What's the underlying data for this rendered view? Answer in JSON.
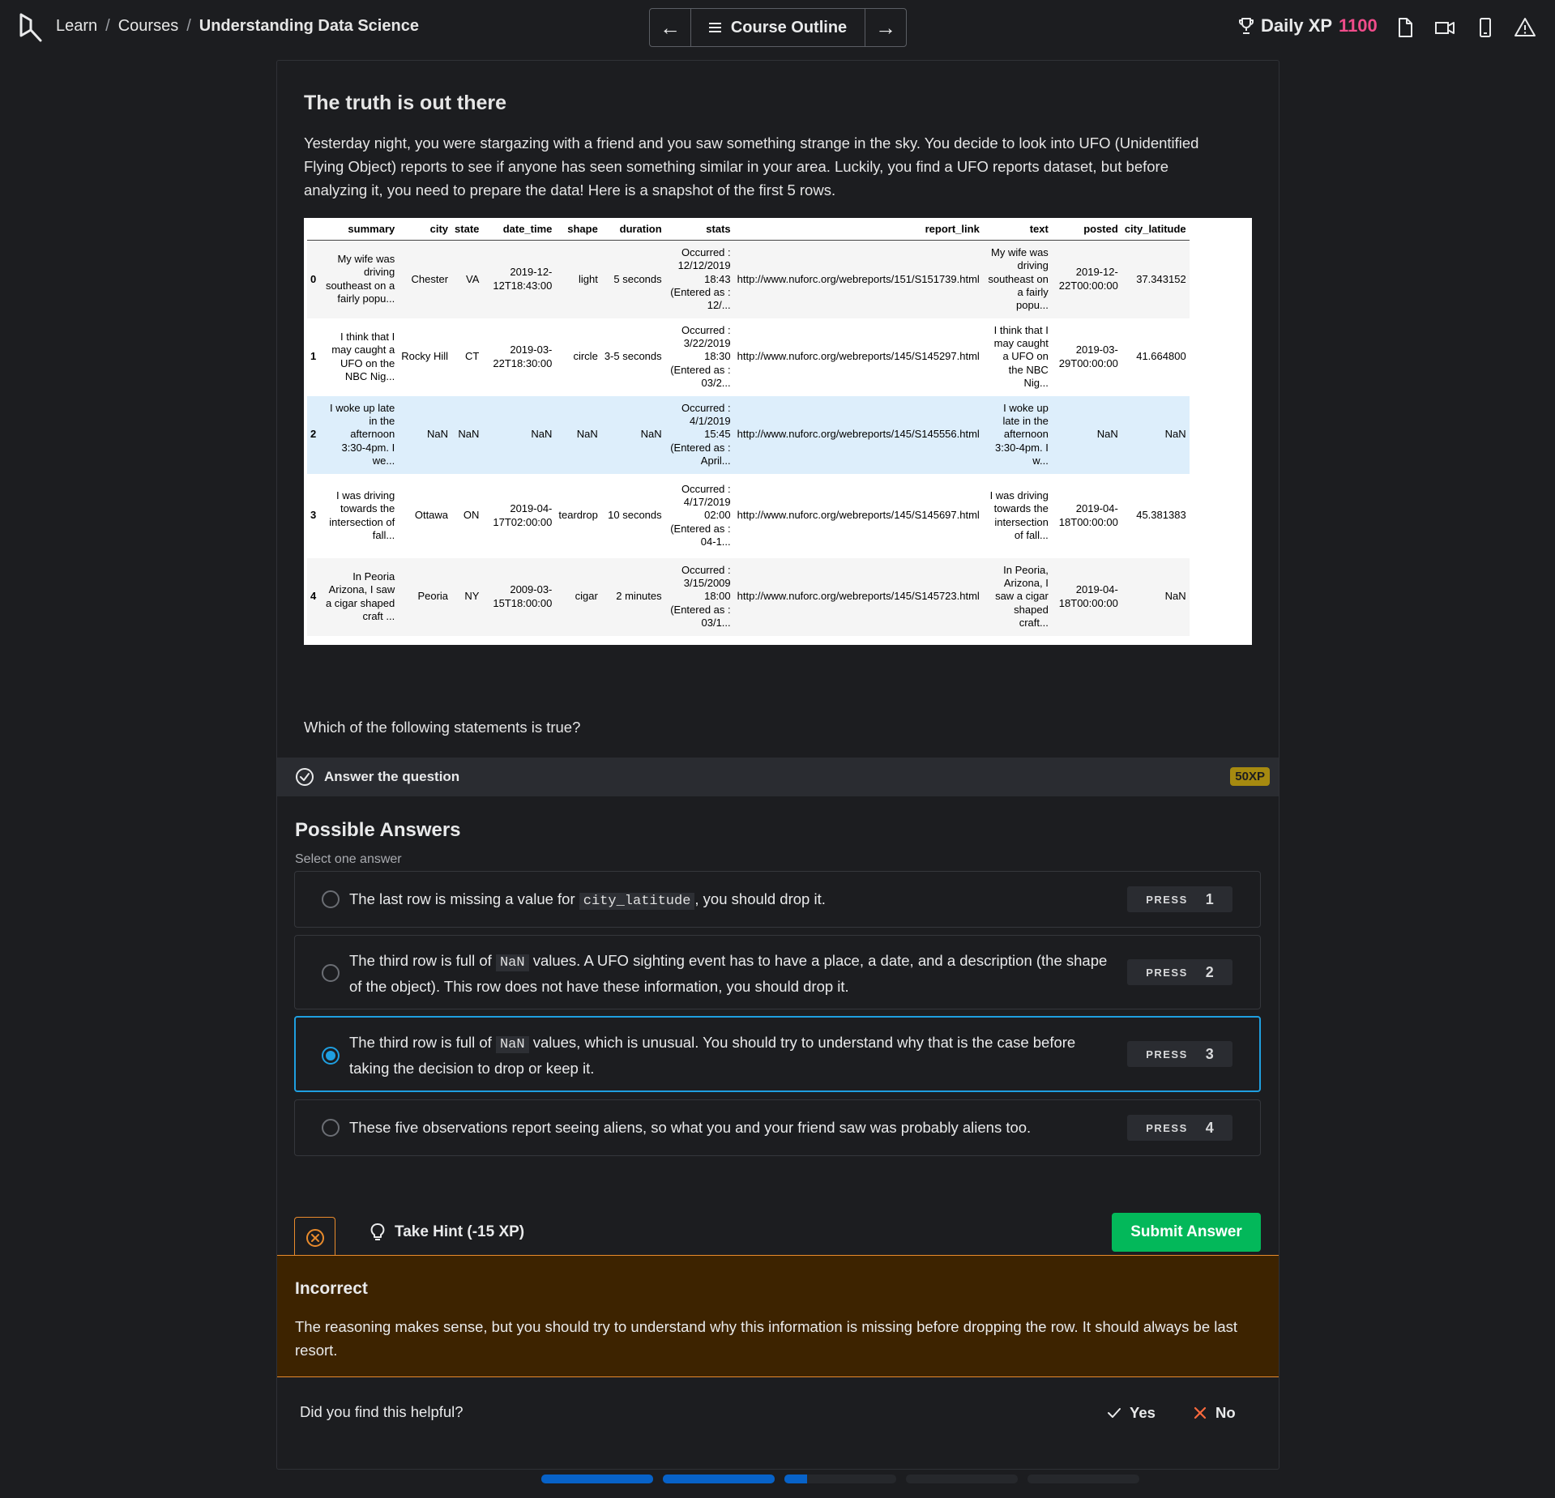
{
  "breadcrumb": {
    "learn": "Learn",
    "sep": "/",
    "courses": "Courses",
    "course": "Understanding Data Science"
  },
  "nav": {
    "outline_label": "Course Outline",
    "prev": "←",
    "next": "→"
  },
  "xp": {
    "label": "Daily XP",
    "value": "1100"
  },
  "exercise": {
    "title": "The truth is out there",
    "intro": "Yesterday night, you were stargazing with a friend and you saw something strange in the sky. You decide to look into UFO (Unidentified Flying Object) reports to see if anyone has seen something similar in your area. Luckily, you find a UFO reports dataset, but before analyzing it, you need to prepare the data! Here is a snapshot of the first 5 rows.",
    "question": "Which of the following statements is true?"
  },
  "table": {
    "columns": [
      "summary",
      "city",
      "state",
      "date_time",
      "shape",
      "duration",
      "stats",
      "report_link",
      "text",
      "posted",
      "city_latitude"
    ],
    "rows": [
      {
        "idx": "0",
        "summary": "My wife was driving southeast on a fairly popu...",
        "city": "Chester",
        "state": "VA",
        "date_time": "2019-12-12T18:43:00",
        "shape": "light",
        "duration": "5 seconds",
        "stats": "Occurred : 12/12/2019 18:43 (Entered as : 12/...",
        "report_link": "http://www.nuforc.org/webreports/151/S151739.html",
        "text": "My wife was driving southeast on a fairly popu...",
        "posted": "2019-12-22T00:00:00",
        "city_latitude": "37.343152"
      },
      {
        "idx": "1",
        "summary": "I think that I may caught a UFO on the NBC Nig...",
        "city": "Rocky Hill",
        "state": "CT",
        "date_time": "2019-03-22T18:30:00",
        "shape": "circle",
        "duration": "3-5 seconds",
        "stats": "Occurred : 3/22/2019 18:30 (Entered as : 03/2...",
        "report_link": "http://www.nuforc.org/webreports/145/S145297.html",
        "text": "I think that I may caught a UFO on the NBC Nig...",
        "posted": "2019-03-29T00:00:00",
        "city_latitude": "41.664800"
      },
      {
        "idx": "2",
        "summary": "I woke up late in the afternoon 3:30-4pm. I we...",
        "city": "NaN",
        "state": "NaN",
        "date_time": "NaN",
        "shape": "NaN",
        "duration": "NaN",
        "stats": "Occurred : 4/1/2019 15:45 (Entered as : April...",
        "report_link": "http://www.nuforc.org/webreports/145/S145556.html",
        "text": "I woke up late in the afternoon 3:30-4pm. I w...",
        "posted": "NaN",
        "city_latitude": "NaN"
      },
      {
        "idx": "3",
        "summary": "I was driving towards the intersection of fall...",
        "city": "Ottawa",
        "state": "ON",
        "date_time": "2019-04-17T02:00:00",
        "shape": "teardrop",
        "duration": "10 seconds",
        "stats": "Occurred : 4/17/2019 02:00 (Entered as : 04-1...",
        "report_link": "http://www.nuforc.org/webreports/145/S145697.html",
        "text": "I was driving towards the intersection of fall...",
        "posted": "2019-04-18T00:00:00",
        "city_latitude": "45.381383"
      },
      {
        "idx": "4",
        "summary": "In Peoria Arizona, I saw a cigar shaped craft ...",
        "city": "Peoria",
        "state": "NY",
        "date_time": "2009-03-15T18:00:00",
        "shape": "cigar",
        "duration": "2 minutes",
        "stats": "Occurred : 3/15/2009 18:00 (Entered as : 03/1...",
        "report_link": "http://www.nuforc.org/webreports/145/S145723.html",
        "text": "In Peoria, Arizona, I saw a cigar shaped craft...",
        "posted": "2019-04-18T00:00:00",
        "city_latitude": "NaN"
      }
    ]
  },
  "answer_bar": {
    "label": "Answer the question",
    "xp": "50XP"
  },
  "answers": {
    "heading": "Possible Answers",
    "sub": "Select one answer",
    "press_label": "PRESS",
    "options": [
      {
        "before": "The last row is missing a value for ",
        "code": "city_latitude",
        "after": ", you should drop it.",
        "key": "1",
        "selected": false
      },
      {
        "before": "The third row is full of ",
        "code": "NaN",
        "after": " values. A UFO sighting event has to have a place, a date, and a description (the shape of the object). This row does not have these information, you should drop it.",
        "key": "2",
        "selected": false
      },
      {
        "before": "The third row is full of ",
        "code": "NaN",
        "after": " values, which is unusual. You should try to understand why that is the case before taking the decision to drop or keep it.",
        "key": "3",
        "selected": true
      },
      {
        "before": "These five observations report seeing aliens, so what you and your friend saw was probably aliens too.",
        "code": "",
        "after": "",
        "key": "4",
        "selected": false
      }
    ]
  },
  "actions": {
    "hint": "Take Hint (-15 XP)",
    "submit": "Submit Answer"
  },
  "feedback": {
    "title": "Incorrect",
    "text": "The reasoning makes sense, but you should try to understand why this information is missing before dropping the row. It should always be last resort.",
    "helpful": "Did you find this helpful?",
    "yes": "Yes",
    "no": "No"
  },
  "progress": [
    1,
    1,
    0.2,
    0,
    0
  ],
  "colors": {
    "accent": "#1f9fe0",
    "xp_value": "#f04c8a",
    "submit": "#03b85a",
    "warning": "#e98b2c",
    "feedback_bg": "#3d2300",
    "progress": "#0762c8",
    "badge": "#a68a10"
  },
  "icons": {
    "logo": "datacamp-logo",
    "trophy": "trophy-icon",
    "slides": "document-icon",
    "video": "video-icon",
    "mobile": "mobile-icon",
    "report": "warning-icon"
  }
}
